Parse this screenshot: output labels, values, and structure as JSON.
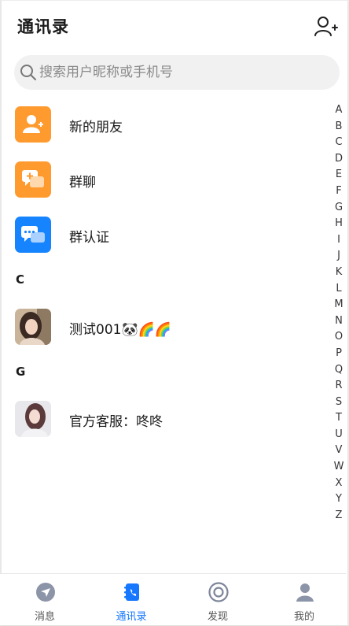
{
  "header": {
    "title": "通讯录",
    "add_friend_icon": "add-person-icon"
  },
  "search": {
    "placeholder": "搜索用户昵称或手机号",
    "value": ""
  },
  "quick_entries": [
    {
      "label": "新的朋友",
      "icon": "new-friend-icon",
      "color": "#ff9a2e"
    },
    {
      "label": "群聊",
      "icon": "group-chat-icon",
      "color": "#ff9a2e"
    },
    {
      "label": "群认证",
      "icon": "group-auth-icon",
      "color": "#1784ff"
    }
  ],
  "sections": [
    {
      "letter": "C",
      "contacts": [
        {
          "name": "测试001",
          "emoji": "🐼🌈🌈"
        }
      ]
    },
    {
      "letter": "G",
      "contacts": [
        {
          "name": "官方客服：咚咚"
        }
      ]
    }
  ],
  "index_letters": [
    "A",
    "B",
    "C",
    "D",
    "E",
    "F",
    "G",
    "H",
    "I",
    "J",
    "K",
    "L",
    "M",
    "N",
    "O",
    "P",
    "Q",
    "R",
    "S",
    "T",
    "U",
    "V",
    "W",
    "X",
    "Y",
    "Z"
  ],
  "tabbar": {
    "active": "通讯录",
    "accent": "#1677ff",
    "tabs": [
      {
        "label": "消息",
        "icon": "message-icon"
      },
      {
        "label": "通讯录",
        "icon": "contacts-icon"
      },
      {
        "label": "发现",
        "icon": "discover-icon"
      },
      {
        "label": "我的",
        "icon": "profile-icon"
      }
    ]
  }
}
